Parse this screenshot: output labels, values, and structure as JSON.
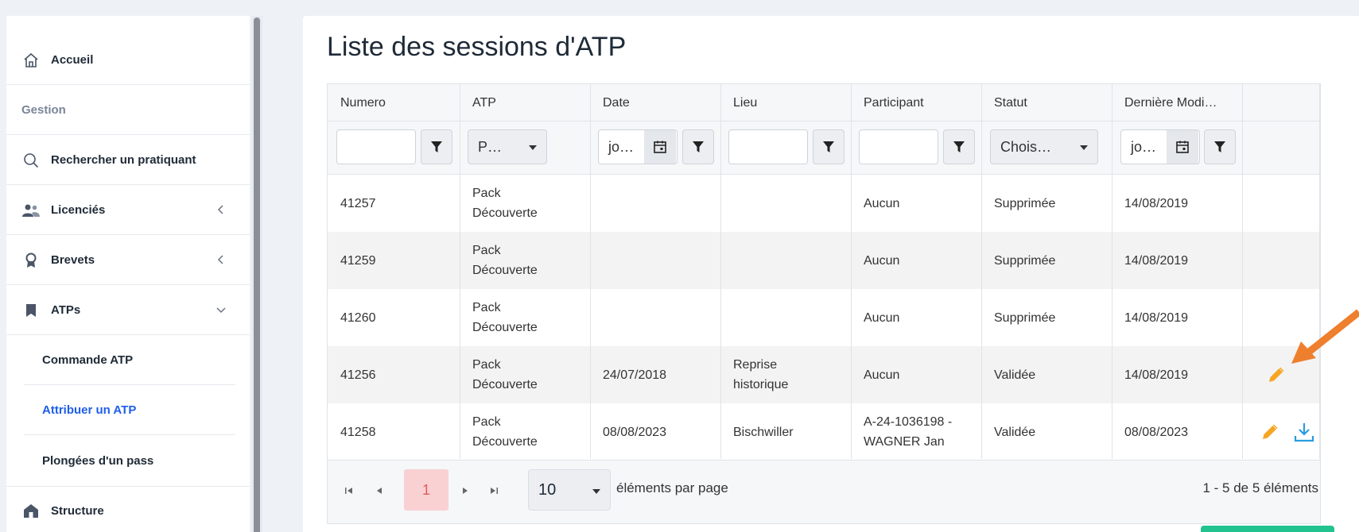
{
  "sidebar": {
    "home": "Accueil",
    "section_gestion": "Gestion",
    "search": "Rechercher un pratiquant",
    "licencies": "Licenciés",
    "brevets": "Brevets",
    "atps": "ATPs",
    "commande": "Commande ATP",
    "attribuer": "Attribuer un ATP",
    "plongees": "Plongées d'un pass",
    "structure": "Structure"
  },
  "page": {
    "title": "Liste des sessions d'ATP"
  },
  "grid": {
    "columns": [
      "Numero",
      "ATP",
      "Date",
      "Lieu",
      "Participant",
      "Statut",
      "Dernière Modi…"
    ],
    "filters": {
      "atp_select": "P…",
      "date_input": "jo…",
      "statut_select": "Chois…",
      "modif_input": "jo…"
    },
    "rows": [
      {
        "numero": "41257",
        "atp": "Pack Découverte",
        "date": "",
        "lieu": "",
        "participant": "Aucun",
        "statut": "Supprimée",
        "modif": "14/08/2019"
      },
      {
        "numero": "41259",
        "atp": "Pack Découverte",
        "date": "",
        "lieu": "",
        "participant": "Aucun",
        "statut": "Supprimée",
        "modif": "14/08/2019"
      },
      {
        "numero": "41260",
        "atp": "Pack Découverte",
        "date": "",
        "lieu": "",
        "participant": "Aucun",
        "statut": "Supprimée",
        "modif": "14/08/2019"
      },
      {
        "numero": "41256",
        "atp": "Pack Découverte",
        "date": "24/07/2018",
        "lieu": "Reprise historique",
        "participant": "Aucun",
        "statut": "Validée",
        "modif": "14/08/2019"
      },
      {
        "numero": "41258",
        "atp": "Pack Découverte",
        "date": "08/08/2023",
        "lieu": "Bischwiller",
        "participant": "A-24-1036198 - WAGNER Jan",
        "statut": "Validée",
        "modif": "08/08/2023"
      }
    ]
  },
  "pager": {
    "current_page": "1",
    "page_size": "10",
    "per_page_label": "éléments par page",
    "info": "1 - 5 de 5 éléments"
  },
  "colors": {
    "accent_blue": "#1d5ee8",
    "edit_orange": "#f5a623",
    "download_blue": "#2a9be0",
    "arrow_orange": "#ee7f2d",
    "pager_active_bg": "#f9d1d3",
    "green_button": "#22c38e"
  }
}
